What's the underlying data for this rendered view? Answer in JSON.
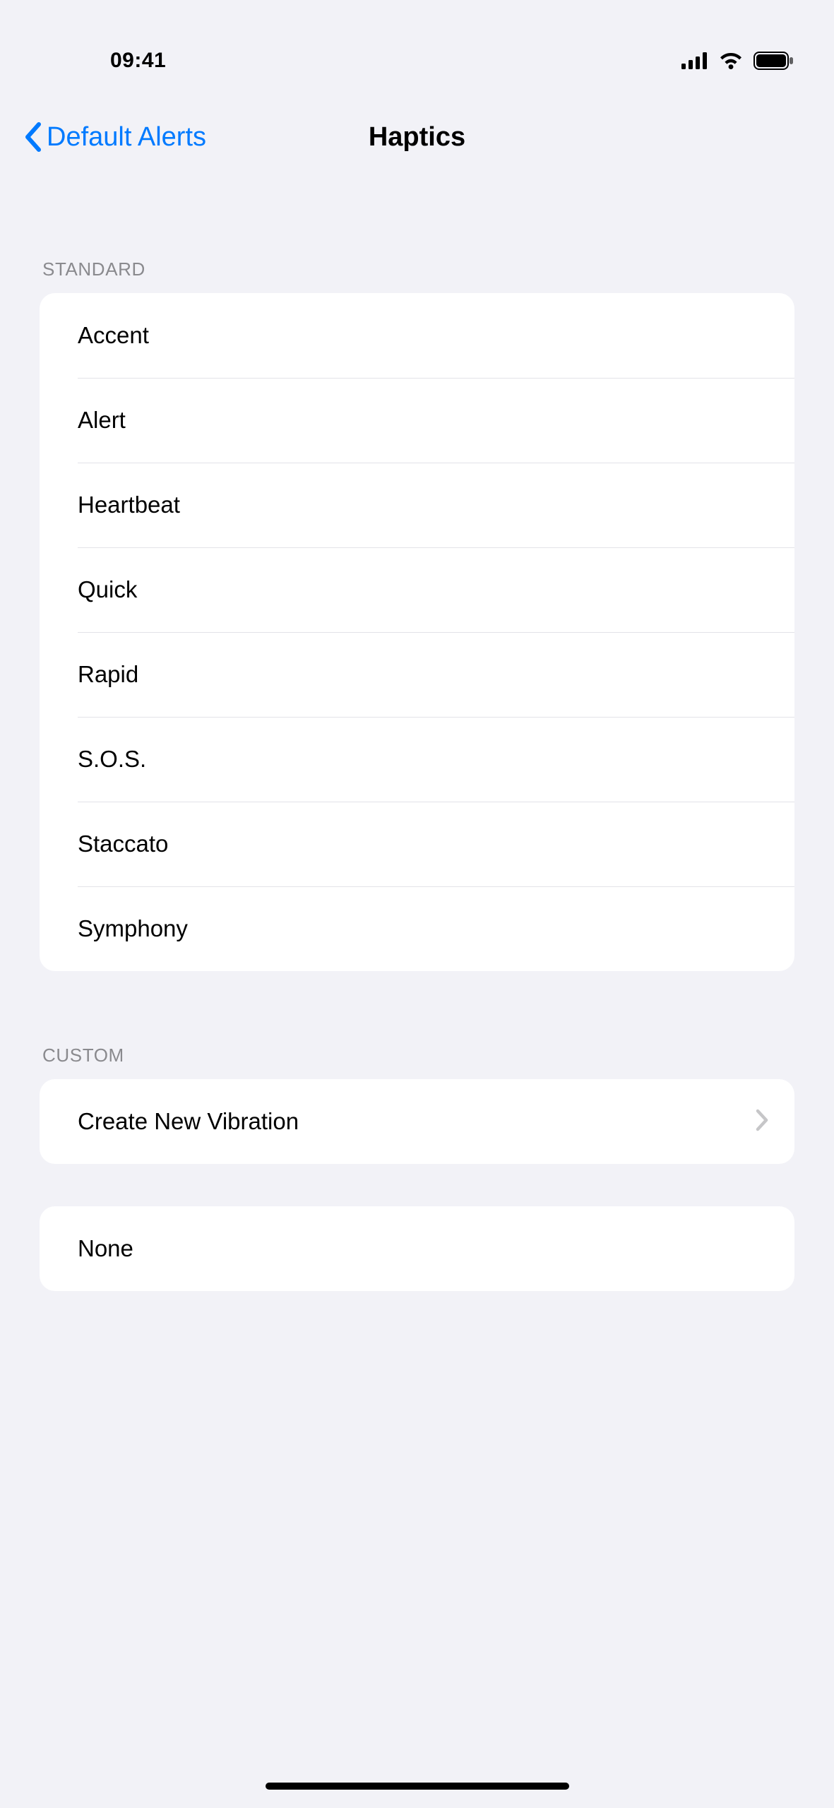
{
  "status": {
    "time": "09:41"
  },
  "nav": {
    "back_label": "Default Alerts",
    "title": "Haptics"
  },
  "sections": {
    "standard": {
      "header": "Standard",
      "items": [
        {
          "label": "Accent"
        },
        {
          "label": "Alert"
        },
        {
          "label": "Heartbeat"
        },
        {
          "label": "Quick"
        },
        {
          "label": "Rapid"
        },
        {
          "label": "S.O.S."
        },
        {
          "label": "Staccato"
        },
        {
          "label": "Symphony"
        }
      ]
    },
    "custom": {
      "header": "Custom",
      "create_label": "Create New Vibration"
    },
    "none_label": "None"
  }
}
